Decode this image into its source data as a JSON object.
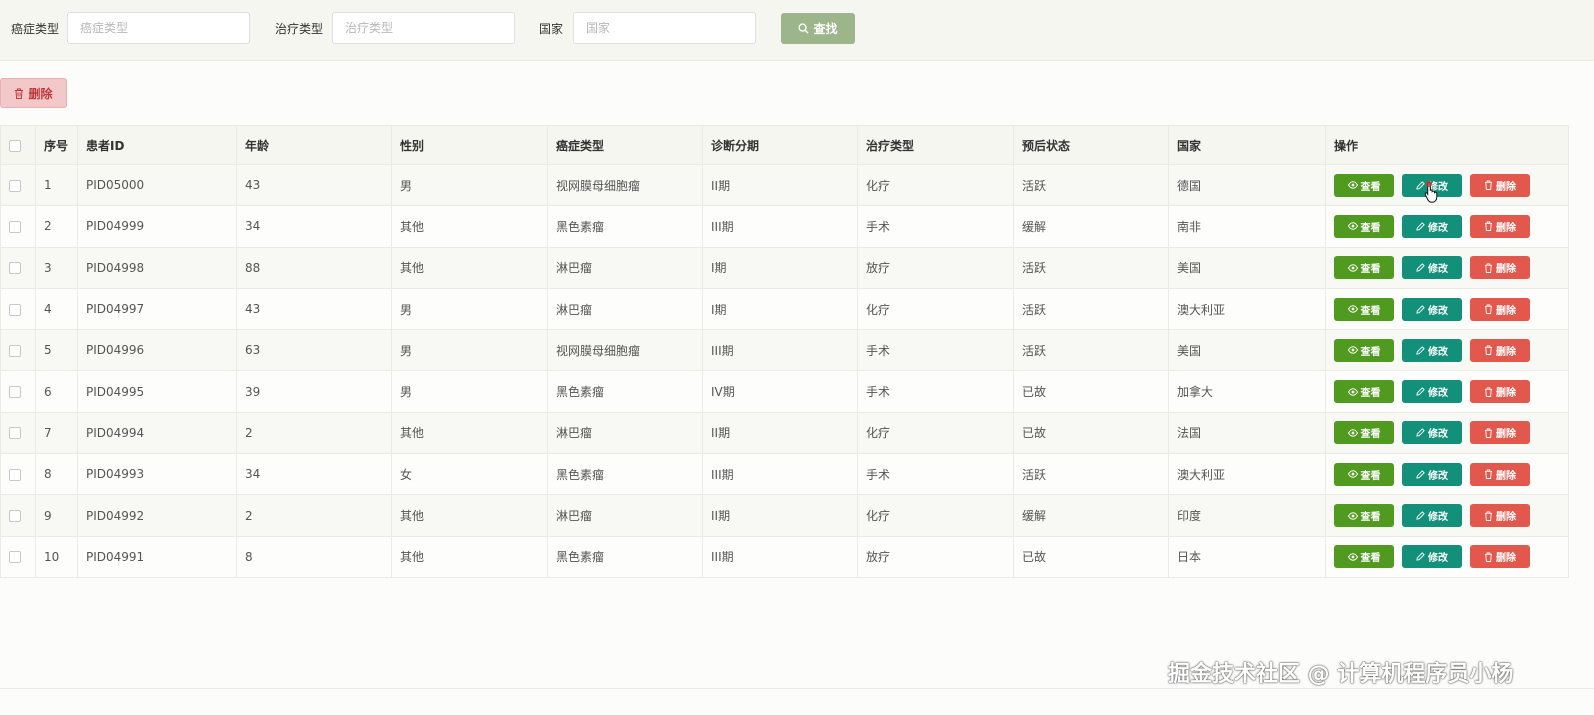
{
  "search": {
    "cancer_label": "癌症类型",
    "cancer_placeholder": "癌症类型",
    "treatment_label": "治疗类型",
    "treatment_placeholder": "治疗类型",
    "country_label": "国家",
    "country_placeholder": "国家",
    "search_button": "查找"
  },
  "toolbar": {
    "delete_label": "删除"
  },
  "table": {
    "headers": [
      "序号",
      "患者ID",
      "年龄",
      "性别",
      "癌症类型",
      "诊断分期",
      "治疗类型",
      "预后状态",
      "国家",
      "操作"
    ],
    "actions": {
      "view": "查看",
      "edit": "修改",
      "delete": "删除"
    },
    "rows": [
      [
        "1",
        "PID05000",
        "43",
        "男",
        "视网膜母细胞瘤",
        "II期",
        "化疗",
        "活跃",
        "德国"
      ],
      [
        "2",
        "PID04999",
        "34",
        "其他",
        "黑色素瘤",
        "III期",
        "手术",
        "缓解",
        "南非"
      ],
      [
        "3",
        "PID04998",
        "88",
        "其他",
        "淋巴瘤",
        "I期",
        "放疗",
        "活跃",
        "美国"
      ],
      [
        "4",
        "PID04997",
        "43",
        "男",
        "淋巴瘤",
        "I期",
        "化疗",
        "活跃",
        "澳大利亚"
      ],
      [
        "5",
        "PID04996",
        "63",
        "男",
        "视网膜母细胞瘤",
        "III期",
        "手术",
        "活跃",
        "美国"
      ],
      [
        "6",
        "PID04995",
        "39",
        "男",
        "黑色素瘤",
        "IV期",
        "手术",
        "已故",
        "加拿大"
      ],
      [
        "7",
        "PID04994",
        "2",
        "其他",
        "淋巴瘤",
        "II期",
        "化疗",
        "已故",
        "法国"
      ],
      [
        "8",
        "PID04993",
        "34",
        "女",
        "黑色素瘤",
        "III期",
        "手术",
        "活跃",
        "澳大利亚"
      ],
      [
        "9",
        "PID04992",
        "2",
        "其他",
        "淋巴瘤",
        "II期",
        "化疗",
        "缓解",
        "印度"
      ],
      [
        "10",
        "PID04991",
        "8",
        "其他",
        "黑色素瘤",
        "III期",
        "放疗",
        "已故",
        "日本"
      ]
    ]
  },
  "watermark": "掘金技术社区 @ 计算机程序员小杨",
  "colors": {
    "search_button": "#9db58b",
    "view": "#4f9a1f",
    "edit": "#13907a",
    "delete": "#e2584d"
  },
  "icons": {
    "search": "search-icon",
    "trash": "trash-icon",
    "eye": "eye-icon",
    "pencil": "pencil-icon"
  }
}
